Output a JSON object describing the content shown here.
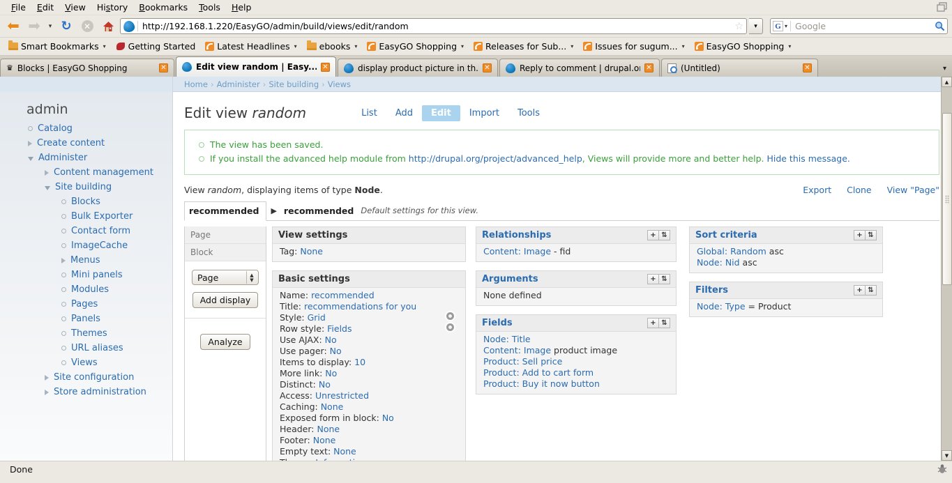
{
  "browser": {
    "menu": [
      "File",
      "Edit",
      "View",
      "History",
      "Bookmarks",
      "Tools",
      "Help"
    ],
    "nav": {
      "back_icon": "back-arrow-icon",
      "forward_icon": "forward-arrow-icon",
      "history_caret": "▾",
      "reload_icon": "↻",
      "stop_icon": "✕",
      "home_icon": "🏠"
    },
    "url": "http://192.168.1.220/EasyGO/admin/build/views/edit/random",
    "url_star": "☆",
    "url_dropdown_caret": "▾",
    "search": {
      "engine": "G",
      "caret": "▾",
      "placeholder": "Google",
      "icon": "🔍"
    },
    "bookmarks": [
      {
        "label": "Smart Bookmarks",
        "icon": "folder-icon",
        "caret": "▾"
      },
      {
        "label": "Getting Started",
        "icon": "firefox-icon",
        "caret": ""
      },
      {
        "label": "Latest Headlines",
        "icon": "rss-icon",
        "caret": "▾"
      },
      {
        "label": "ebooks",
        "icon": "folder-icon",
        "caret": "▾"
      },
      {
        "label": "EasyGO Shopping",
        "icon": "rss-icon",
        "caret": "▾"
      },
      {
        "label": "Releases for Sub...",
        "icon": "rss-icon",
        "caret": "▾"
      },
      {
        "label": "Issues for sugum...",
        "icon": "rss-icon",
        "caret": "▾"
      },
      {
        "label": "EasyGO Shopping",
        "icon": "rss-icon",
        "caret": "▾"
      }
    ],
    "tabs": [
      {
        "label": "Blocks | EasyGO Shopping",
        "icon": "crown-icon",
        "active": false,
        "close": "✕"
      },
      {
        "label": "Edit view random | Easy...",
        "icon": "drupal-icon",
        "active": true,
        "close": "✕"
      },
      {
        "label": "display product picture in th...",
        "icon": "drupal-icon",
        "active": false,
        "close": "✕"
      },
      {
        "label": "Reply to comment | drupal.org",
        "icon": "drupal-icon",
        "active": false,
        "close": "✕"
      },
      {
        "label": "(Untitled)",
        "icon": "page-icon",
        "active": false,
        "close": "✕"
      }
    ],
    "tabs_overflow_caret": "▾",
    "status": {
      "text": "Done",
      "bug_icon": "🐞"
    }
  },
  "sidebar": {
    "title": "admin",
    "items": [
      {
        "label": "Catalog",
        "level": 1,
        "marker": "bullet"
      },
      {
        "label": "Create content",
        "level": 1,
        "marker": "collapsed"
      },
      {
        "label": "Administer",
        "level": 1,
        "marker": "expanded"
      },
      {
        "label": "Content management",
        "level": 2,
        "marker": "collapsed"
      },
      {
        "label": "Site building",
        "level": 2,
        "marker": "expanded"
      },
      {
        "label": "Blocks",
        "level": 3,
        "marker": "bullet"
      },
      {
        "label": "Bulk Exporter",
        "level": 3,
        "marker": "bullet"
      },
      {
        "label": "Contact form",
        "level": 3,
        "marker": "bullet"
      },
      {
        "label": "ImageCache",
        "level": 3,
        "marker": "bullet"
      },
      {
        "label": "Menus",
        "level": 3,
        "marker": "collapsed"
      },
      {
        "label": "Mini panels",
        "level": 3,
        "marker": "bullet"
      },
      {
        "label": "Modules",
        "level": 3,
        "marker": "bullet"
      },
      {
        "label": "Pages",
        "level": 3,
        "marker": "bullet"
      },
      {
        "label": "Panels",
        "level": 3,
        "marker": "bullet"
      },
      {
        "label": "Themes",
        "level": 3,
        "marker": "bullet"
      },
      {
        "label": "URL aliases",
        "level": 3,
        "marker": "bullet"
      },
      {
        "label": "Views",
        "level": 3,
        "marker": "bullet"
      },
      {
        "label": "Site configuration",
        "level": 2,
        "marker": "collapsed"
      },
      {
        "label": "Store administration",
        "level": 2,
        "marker": "collapsed"
      }
    ]
  },
  "page": {
    "breadcrumb": [
      "Home",
      "Administer",
      "Site building",
      "Views"
    ],
    "breadcrumb_sep": "›",
    "title_prefix": "Edit view ",
    "title_em": "random",
    "subtabs": [
      {
        "label": "List",
        "active": false
      },
      {
        "label": "Add",
        "active": false
      },
      {
        "label": "Edit",
        "active": true
      },
      {
        "label": "Import",
        "active": false
      },
      {
        "label": "Tools",
        "active": false
      }
    ],
    "messages": [
      {
        "text": "The view has been saved."
      },
      {
        "pre": "If you install the advanced help module from ",
        "link1": "http://drupal.org/project/advanced_help",
        "mid": ", Views will provide more and better help. ",
        "link2": "Hide this message."
      }
    ],
    "view_info": {
      "pre": "View ",
      "name": "random",
      "mid": ", displaying items of type ",
      "type": "Node",
      "post": "."
    },
    "view_actions": [
      "Export",
      "Clone",
      "View \"Page\""
    ],
    "display_tab": {
      "tab_label": "recommended",
      "arrow": "▶",
      "name": "recommended",
      "description": "Default settings for this view."
    },
    "displays": {
      "items": [
        "Page",
        "Block"
      ],
      "select_value": "Page",
      "add_button": "Add display",
      "analyze_button": "Analyze",
      "spin_up": "▲",
      "spin_down": "▼"
    },
    "buckets": {
      "view_settings": {
        "title": "View settings",
        "rows": [
          {
            "label": "Tag:",
            "value": "None"
          }
        ]
      },
      "basic_settings": {
        "title": "Basic settings",
        "rows": [
          {
            "label": "Name:",
            "value": "recommended"
          },
          {
            "label": "Title:",
            "value": "recommendations for you"
          },
          {
            "label": "Style:",
            "value": "Grid",
            "gear": true
          },
          {
            "label": "Row style:",
            "value": "Fields",
            "gear": true
          },
          {
            "label": "Use AJAX:",
            "value": "No"
          },
          {
            "label": "Use pager:",
            "value": "No"
          },
          {
            "label": "Items to display:",
            "value": "10"
          },
          {
            "label": "More link:",
            "value": "No"
          },
          {
            "label": "Distinct:",
            "value": "No"
          },
          {
            "label": "Access:",
            "value": "Unrestricted"
          },
          {
            "label": "Caching:",
            "value": "None"
          },
          {
            "label": "Exposed form in block:",
            "value": "No"
          },
          {
            "label": "Header:",
            "value": "None"
          },
          {
            "label": "Footer:",
            "value": "None"
          },
          {
            "label": "Empty text:",
            "value": "None"
          },
          {
            "label": "Theme:",
            "value": "Information"
          }
        ]
      },
      "relationships": {
        "title": "Relationships",
        "add_icon": "+",
        "sort_icon": "⇅",
        "rows": [
          {
            "link": "Content: Image",
            "tail": " - fid"
          }
        ]
      },
      "arguments": {
        "title": "Arguments",
        "add_icon": "+",
        "sort_icon": "⇅",
        "rows": [
          {
            "link": "",
            "tail": "None defined"
          }
        ]
      },
      "fields": {
        "title": "Fields",
        "add_icon": "+",
        "sort_icon": "⇅",
        "rows": [
          {
            "pre": "Node: ",
            "link": "Title",
            "tail": ""
          },
          {
            "pre": "Content: ",
            "link": "Image",
            "tail": " product image"
          },
          {
            "pre": "Product: ",
            "link": "Sell price",
            "tail": ""
          },
          {
            "pre": "Product: ",
            "link": "Add to cart form",
            "tail": ""
          },
          {
            "pre": "Product: ",
            "link": "Buy it now button",
            "tail": ""
          }
        ]
      },
      "sort_criteria": {
        "title": "Sort criteria",
        "add_icon": "+",
        "sort_icon": "⇅",
        "rows": [
          {
            "pre": "Global: ",
            "link": "Random",
            "tail": " asc"
          },
          {
            "pre": "Node: ",
            "link": "Nid",
            "tail": " asc"
          }
        ]
      },
      "filters": {
        "title": "Filters",
        "add_icon": "+",
        "sort_icon": "⇅",
        "rows": [
          {
            "pre": "Node: ",
            "link": "Type",
            "tail": " = Product"
          }
        ]
      }
    }
  },
  "colors": {
    "link": "#2b6cb0",
    "success": "#3aa03a",
    "chrome_bg": "#ece9e3",
    "accent_tab": "#a9d3ef",
    "breadcrumb_bg": "#dbe6f0"
  }
}
